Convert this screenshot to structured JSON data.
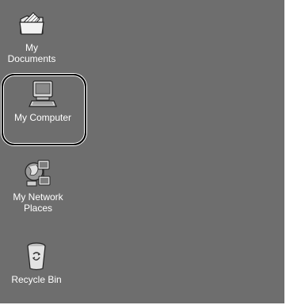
{
  "desktop": {
    "background_color": "#6e6e6e",
    "icons": [
      {
        "label": "My Documents",
        "icon": "folder-documents-icon"
      },
      {
        "label": "My Computer",
        "icon": "computer-icon",
        "selected": true
      },
      {
        "label": "My Network\nPlaces",
        "icon": "network-places-icon"
      },
      {
        "label": "Recycle Bin",
        "icon": "recycle-bin-icon"
      }
    ]
  }
}
